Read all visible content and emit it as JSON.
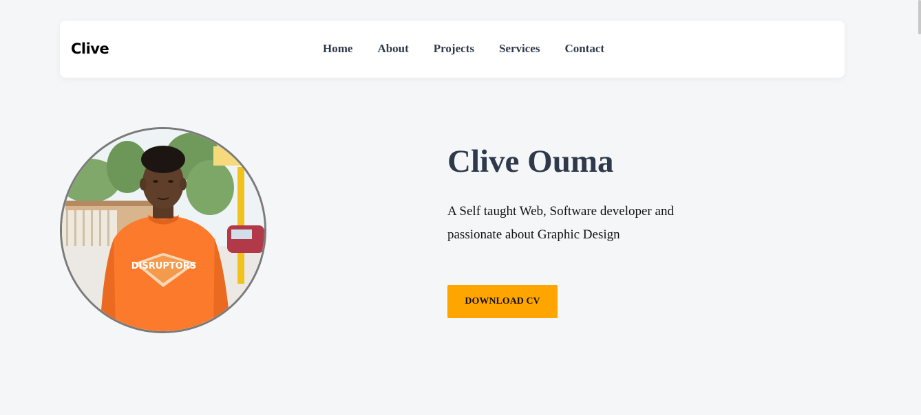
{
  "navbar": {
    "logo": "Clive",
    "links": [
      "Home",
      "About",
      "Projects",
      "Services",
      "Contact"
    ]
  },
  "hero": {
    "name": "Clive Ouma",
    "description": "A Self taught Web, Software developer and passionate about Graphic Design",
    "cv_button": "DOWNLOAD CV",
    "shirt_text": "DISRUPTORS"
  },
  "colors": {
    "background": "#f5f6f8",
    "accent": "#ffa500",
    "heading": "#2e3a4b"
  },
  "icons": {
    "profile": "profile-photo"
  }
}
